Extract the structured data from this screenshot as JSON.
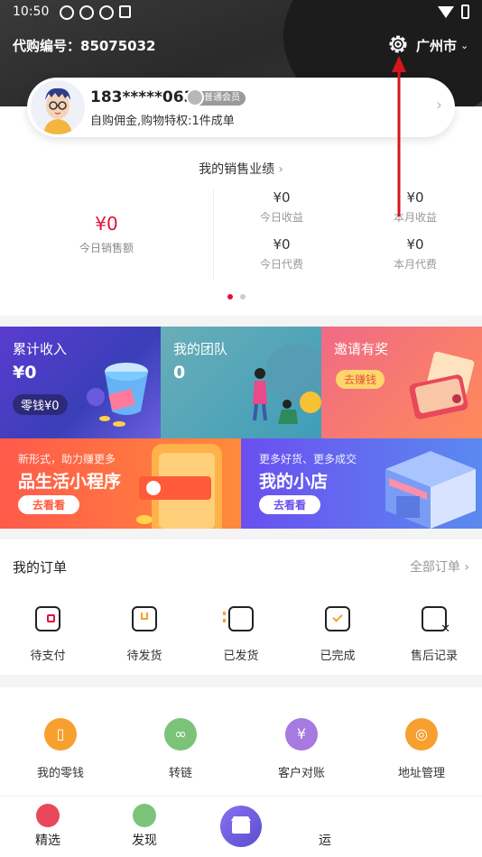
{
  "status": {
    "time": "10:50"
  },
  "header": {
    "agent_id": "代购编号：85075032",
    "city": "广州市"
  },
  "profile": {
    "name": "183*****063",
    "level": "普通会员",
    "desc": "自购佣金,购物特权:1件成单"
  },
  "sales": {
    "title": "我的销售业绩",
    "today_sales_value": "¥0",
    "today_sales_label": "今日销售额",
    "today_income_value": "¥0",
    "today_income_label": "今日收益",
    "month_income_value": "¥0",
    "month_income_label": "本月收益",
    "today_proxy_value": "¥0",
    "today_proxy_label": "今日代费",
    "month_proxy_value": "¥0",
    "month_proxy_label": "本月代费"
  },
  "tiles": {
    "income_title": "累计收入",
    "income_value": "¥0",
    "change_label": "零钱¥0",
    "team_title": "我的团队",
    "team_value": "0",
    "invite_title": "邀请有奖",
    "invite_button": "去赚钱",
    "miniapp_top": "新形式，助力赚更多",
    "miniapp_title": "品生活小程序",
    "miniapp_button": "去看看",
    "shop_top": "更多好货、更多成交",
    "shop_title": "我的小店",
    "shop_button": "去看看"
  },
  "orders": {
    "title": "我的订单",
    "all": "全部订单",
    "items": [
      "待支付",
      "待发货",
      "已发货",
      "已完成",
      "售后记录"
    ]
  },
  "tools": {
    "items": [
      "我的零钱",
      "转链",
      "客户对账",
      "地址管理"
    ]
  },
  "tabbar": {
    "items": [
      "精选",
      "发现",
      "",
      "运"
    ]
  },
  "colors": {
    "accent": "#e0113a",
    "header": "#2a2a2a",
    "orange": "#f7a030",
    "green": "#7cc37a",
    "purple": "#a67ae0"
  }
}
